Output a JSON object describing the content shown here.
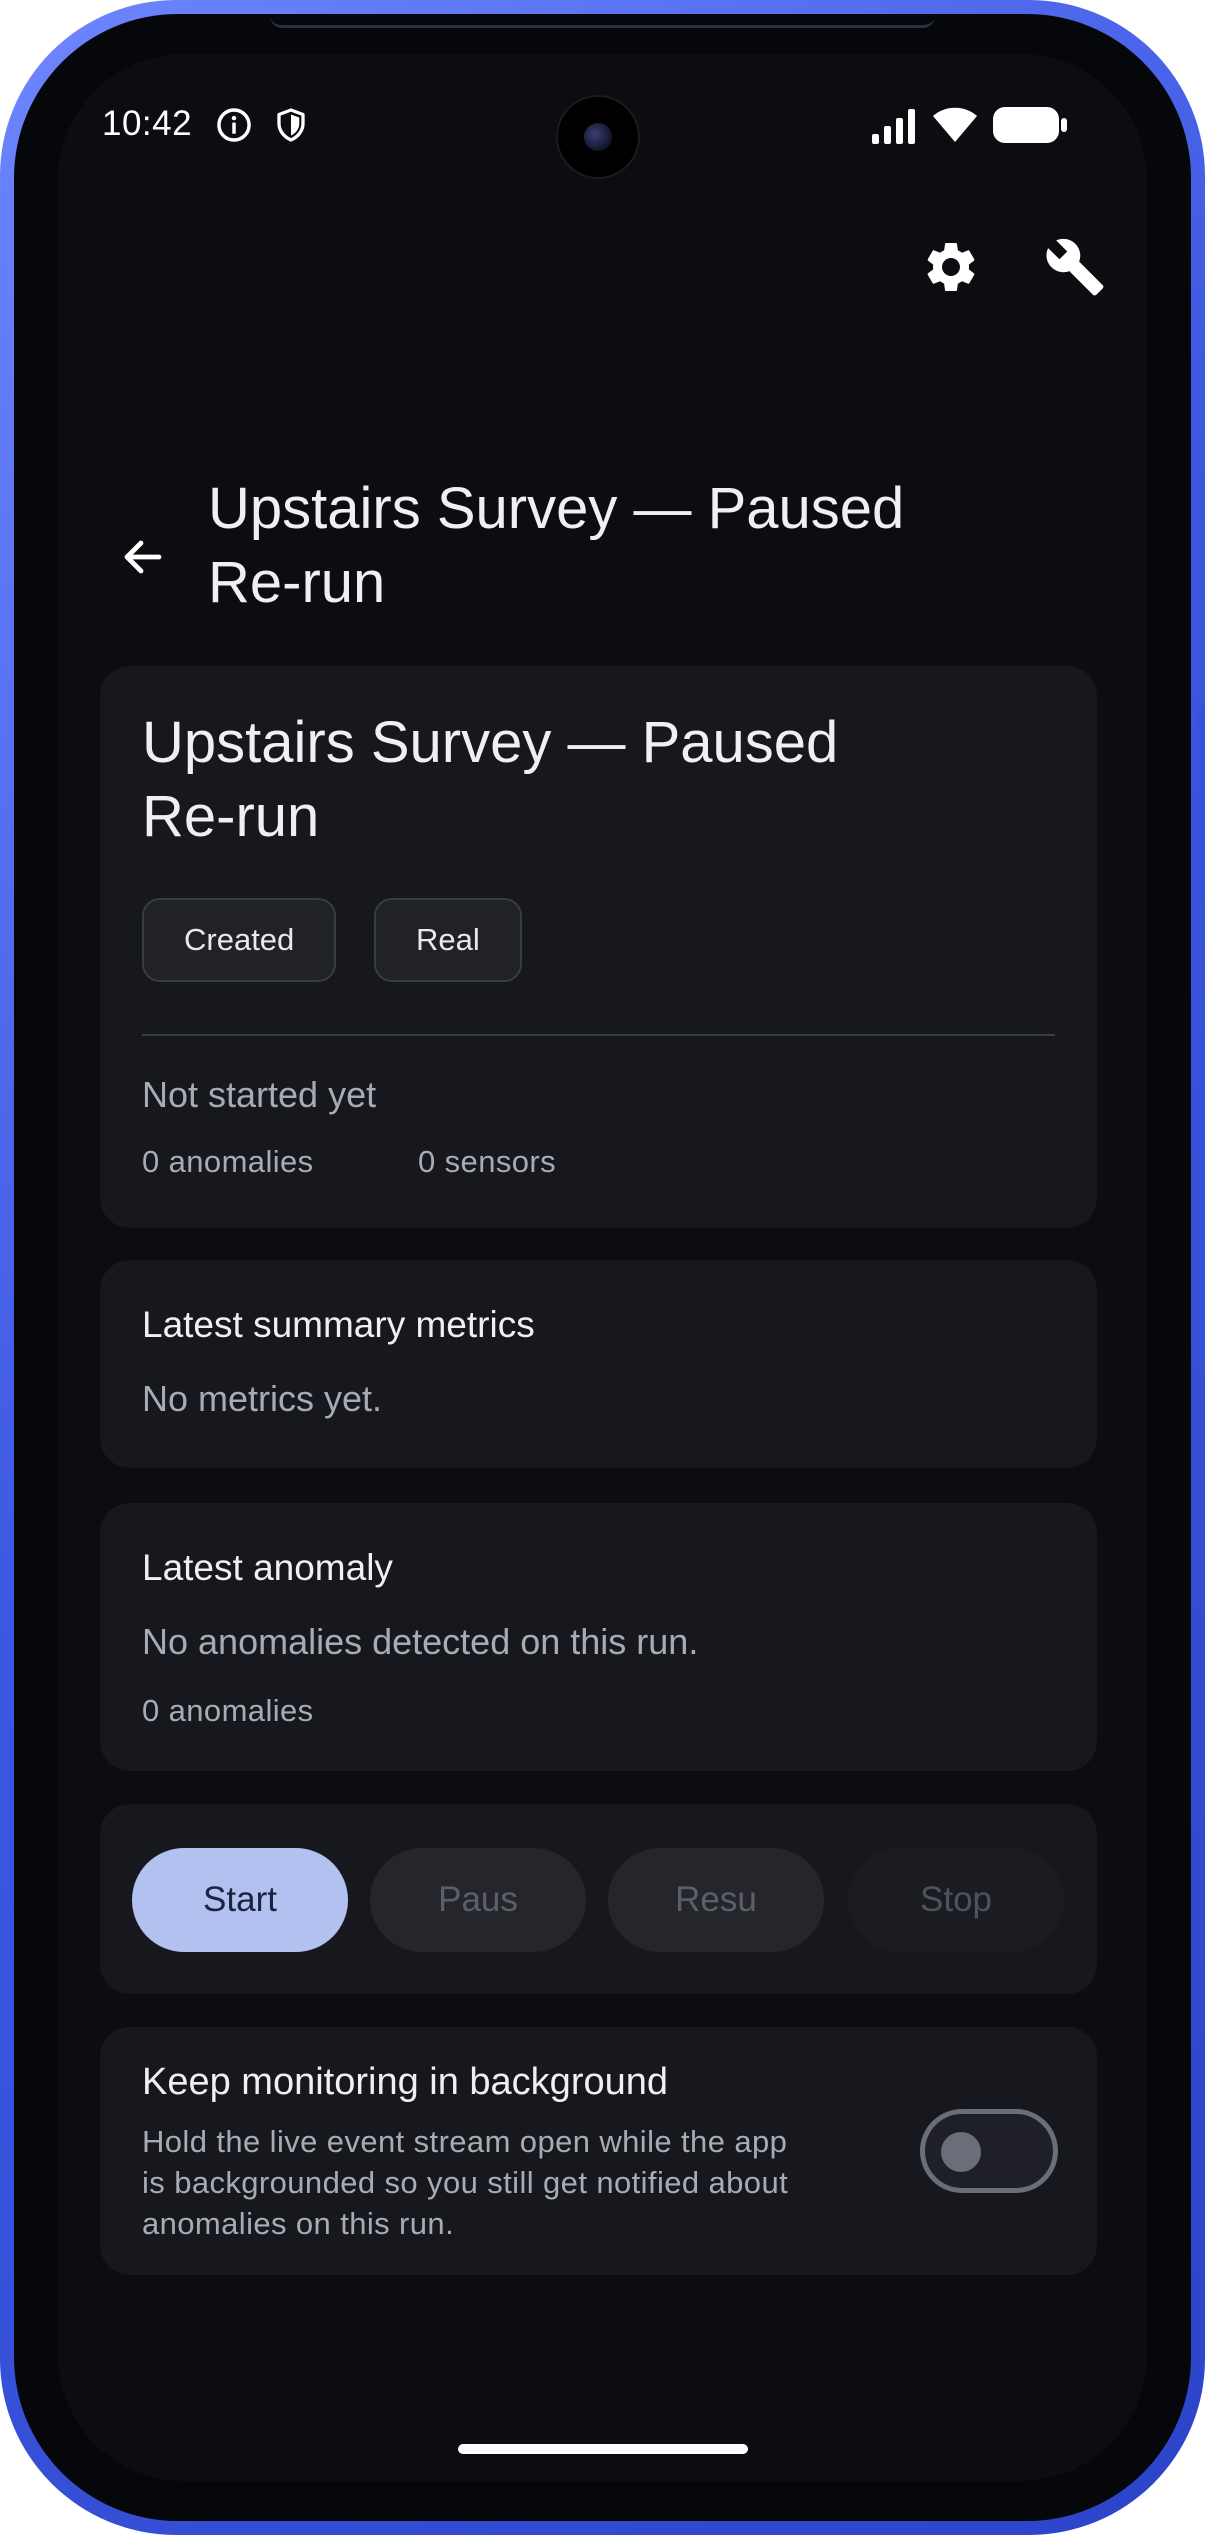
{
  "status_bar": {
    "time": "10:42",
    "icons": [
      "info-icon",
      "shield-icon",
      "signal-icon",
      "wifi-icon",
      "battery-icon"
    ]
  },
  "toolbar": {
    "icons": [
      "gear-icon",
      "wrench-icon"
    ]
  },
  "header": {
    "title_line1": "Upstairs Survey — Paused",
    "title_line2": "Re-run"
  },
  "run_card": {
    "title_line1": "Upstairs Survey — Paused",
    "title_line2": "Re-run",
    "chips": [
      "Created",
      "Real"
    ],
    "status_text": "Not started yet",
    "anomalies_count": "0 anomalies",
    "sensors_count": "0 sensors"
  },
  "metrics_card": {
    "title": "Latest summary metrics",
    "empty_text": "No metrics yet."
  },
  "anomaly_card": {
    "title": "Latest anomaly",
    "empty_text": "No anomalies detected on this run.",
    "count": "0 anomalies"
  },
  "controls": {
    "start": "Start",
    "pause": "Paus",
    "resume": "Resu",
    "stop": "Stop"
  },
  "background_card": {
    "title": "Keep monitoring in background",
    "description_line1": "Hold the live event stream open while the app",
    "description_line2": "is backgrounded so you still get notified about",
    "description_line3": "anomalies on this run.",
    "toggle_on": false
  },
  "colors": {
    "frame": "#3b57e0",
    "screen_bg": "#0c0d11",
    "card_bg": "#17181e",
    "accent": "#b3c1f0"
  }
}
